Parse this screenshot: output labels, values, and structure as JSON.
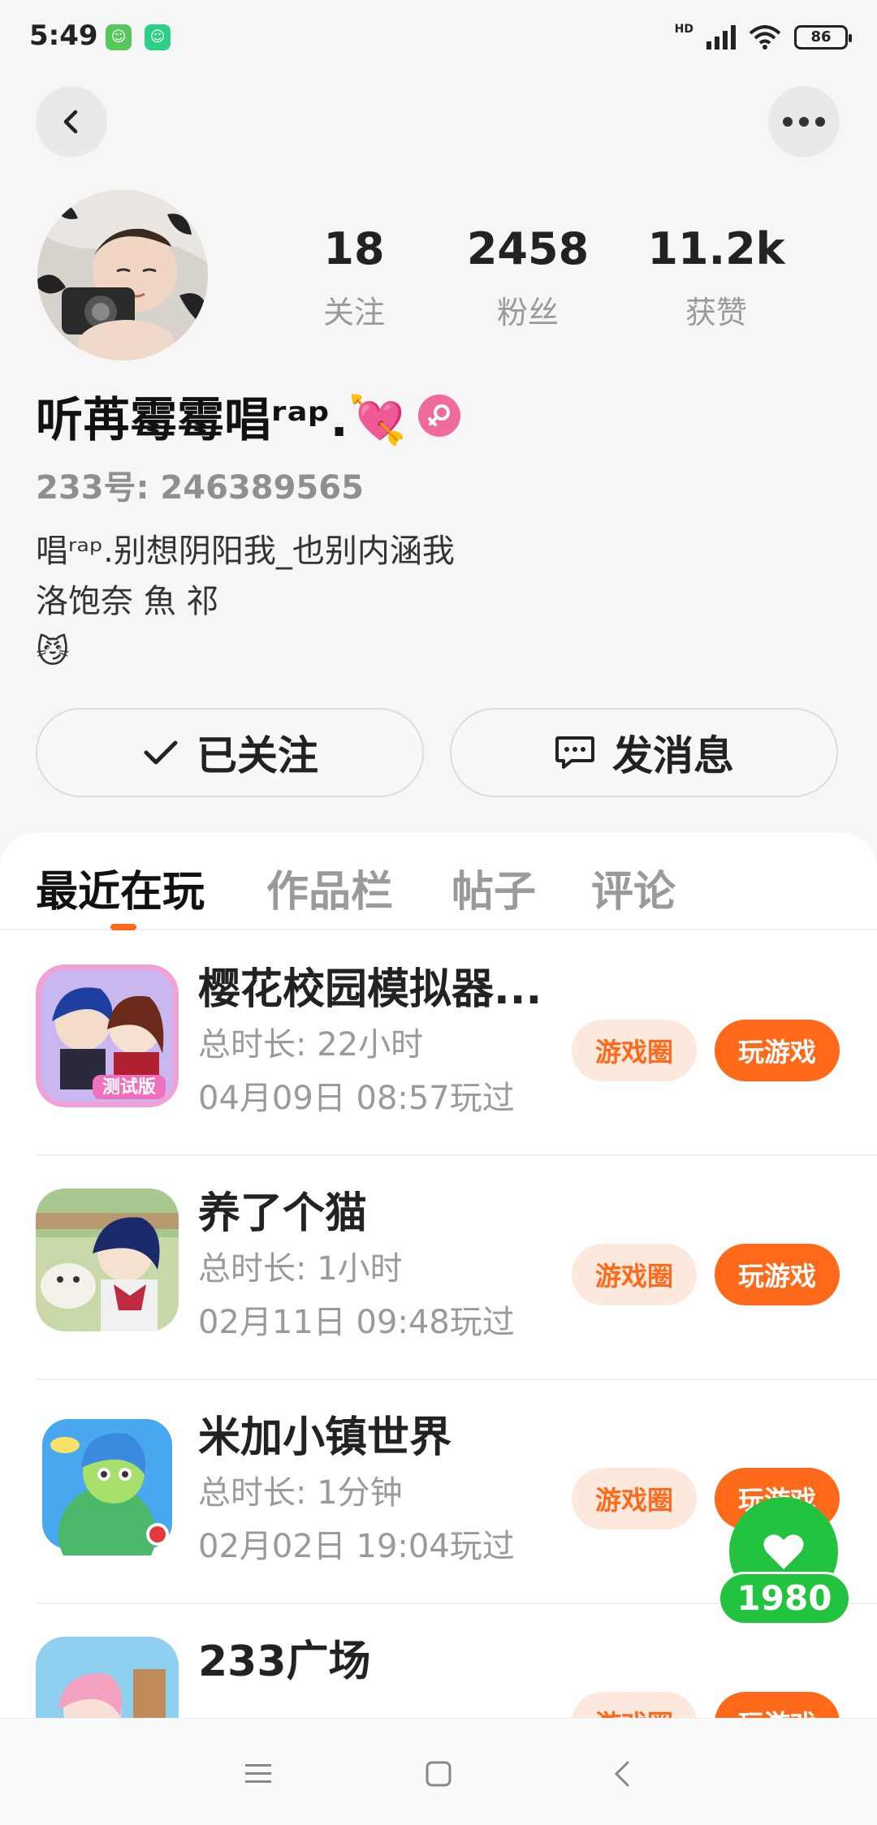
{
  "status_bar": {
    "time": "5:49",
    "network": "HD",
    "battery": "86"
  },
  "nav": {
    "back_icon": "back-arrow-icon",
    "more_icon": "more-dots-icon"
  },
  "profile": {
    "stats": [
      {
        "value": "18",
        "label": "关注"
      },
      {
        "value": "2458",
        "label": "粉丝"
      },
      {
        "value": "11.2k",
        "label": "获赞"
      }
    ],
    "nickname": "听苒霉霉唱ʳᵃᵖ.💘",
    "gender_icon": "female-icon",
    "uid": "233号: 246389565",
    "bio_lines": [
      "唱ʳᵃᵖ.别想阴阳我_也别内涵我",
      "洛饱奈 魚 祁",
      "😼"
    ],
    "follow_button": "已关注",
    "message_button": "发消息"
  },
  "tabs": [
    {
      "label": "最近在玩",
      "active": true
    },
    {
      "label": "作品栏",
      "active": false
    },
    {
      "label": "帖子",
      "active": false
    },
    {
      "label": "评论",
      "active": false
    }
  ],
  "games": [
    {
      "name": "樱花校园模拟器...",
      "duration": "总时长: 22小时",
      "last_played": "04月09日 08:57玩过",
      "circle_label": "游戏圈",
      "play_label": "玩游戏"
    },
    {
      "name": "养了个猫",
      "duration": "总时长: 1小时",
      "last_played": "02月11日 09:48玩过",
      "circle_label": "游戏圈",
      "play_label": "玩游戏"
    },
    {
      "name": "米加小镇世界",
      "duration": "总时长: 1分钟",
      "last_played": "02月02日 19:04玩过",
      "circle_label": "游戏圈",
      "play_label": "玩游戏"
    },
    {
      "name": "233广场",
      "duration": "",
      "last_played": "",
      "circle_label": "游戏圈",
      "play_label": "玩游戏"
    }
  ],
  "floating_like": {
    "count": "1980",
    "icon": "heart-icon"
  },
  "colors": {
    "accent": "#ff6a1a",
    "accent_light": "#fde8dd",
    "like_green": "#22c33e",
    "gender_pink": "#f06a9a"
  }
}
